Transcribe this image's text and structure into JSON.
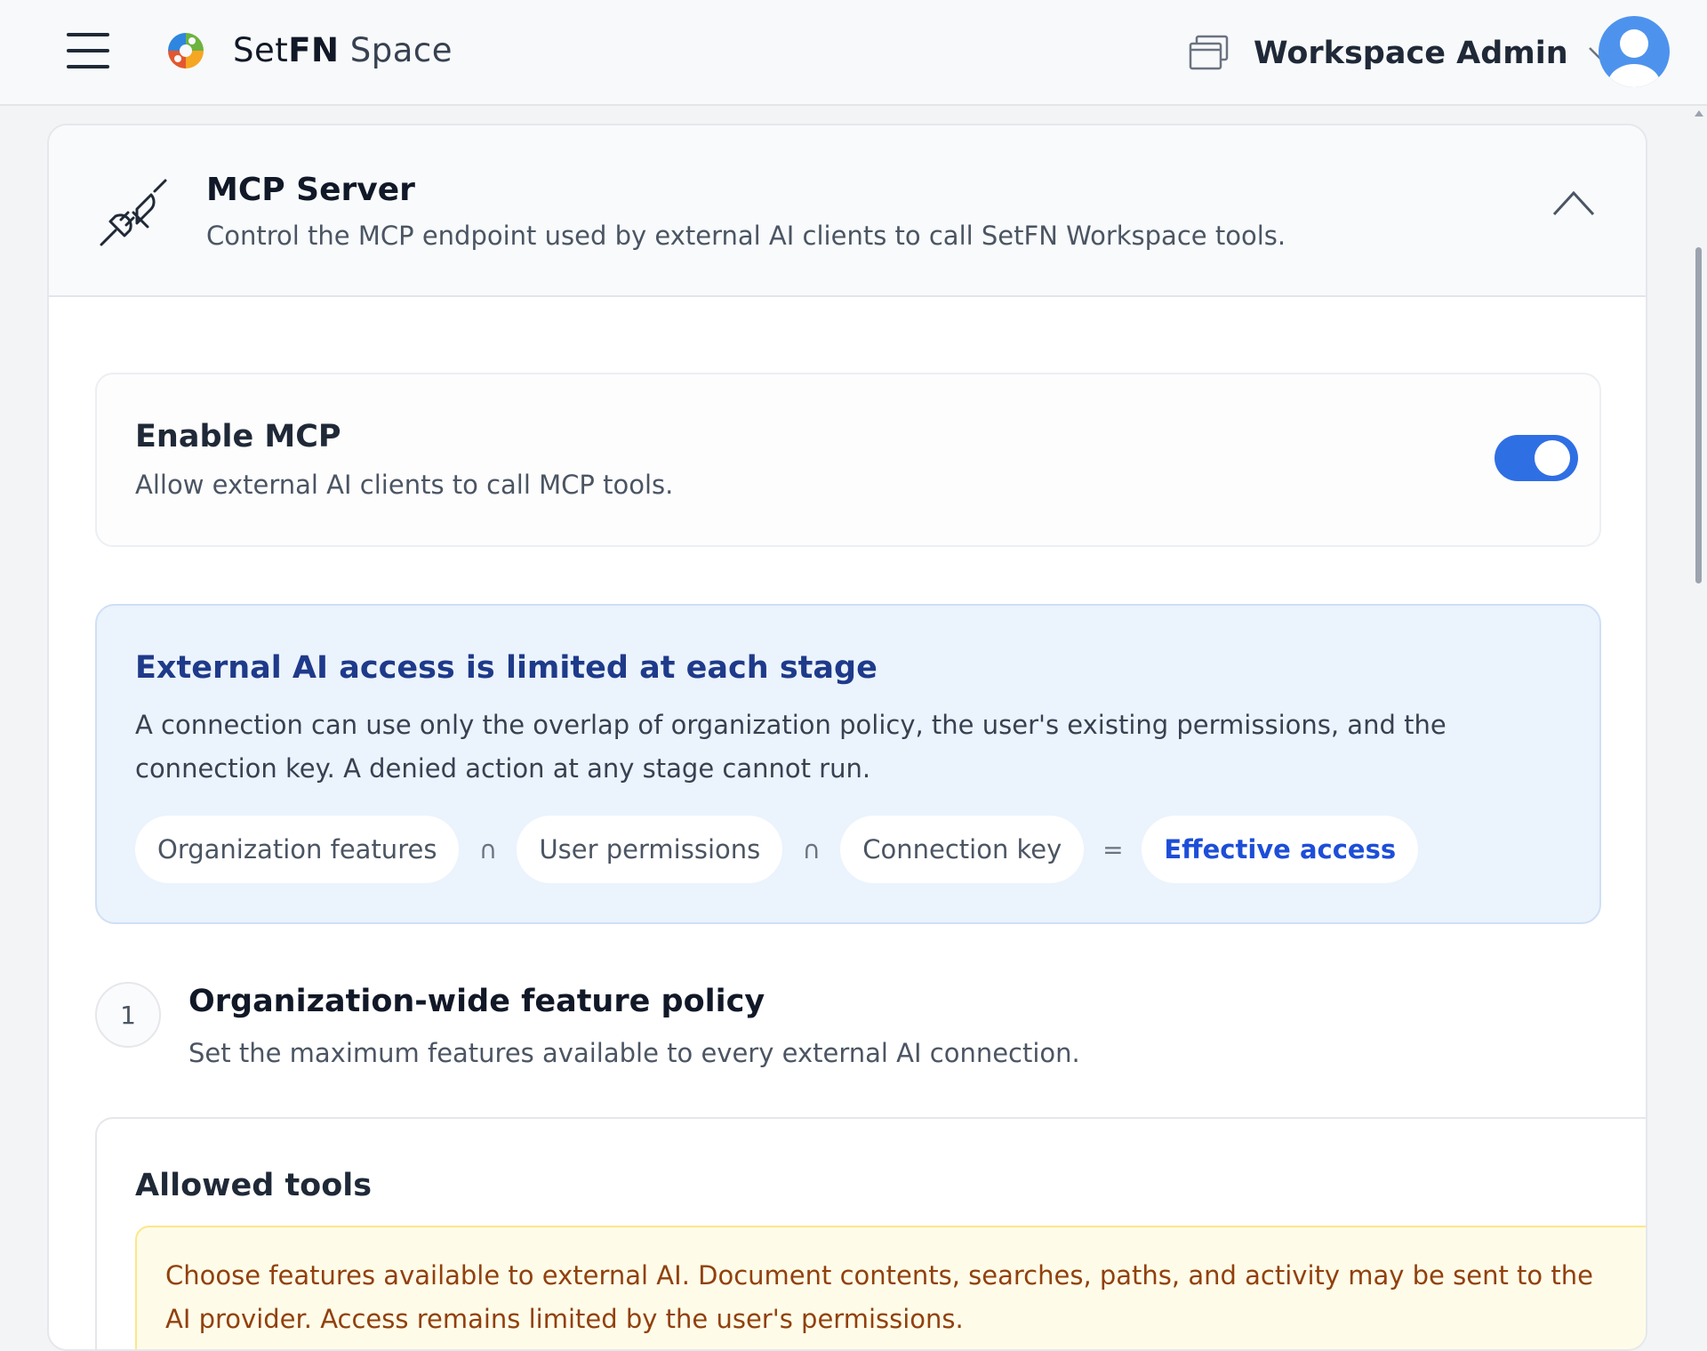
{
  "header": {
    "brand_part1": "Set",
    "brand_part2": "FN",
    "brand_part3": " Space",
    "workspace_name": "Workspace Admin"
  },
  "mcp": {
    "title": "MCP Server",
    "subtitle": "Control the MCP endpoint used by external AI clients to call SetFN Workspace tools.",
    "enable": {
      "title": "Enable MCP",
      "description": "Allow external AI clients to call MCP tools.",
      "enabled": true
    },
    "info": {
      "title": "External AI access is limited at each stage",
      "text": "A connection can use only the overlap of organization policy, the user's existing permissions, and the connection key. A denied action at any stage cannot run.",
      "pills": [
        "Organization features",
        "User permissions",
        "Connection key",
        "Effective access"
      ],
      "ops": [
        "∩",
        "∩",
        "="
      ]
    },
    "step1": {
      "number": "1",
      "title": "Organization-wide feature policy",
      "description": "Set the maximum features available to every external AI connection."
    },
    "tools": {
      "title": "Allowed tools",
      "warning": "Choose features available to external AI. Document contents, searches, paths, and activity may be sent to the AI provider. Access remains limited by the user's permissions."
    }
  },
  "icons": {
    "menu": "hamburger-menu-icon",
    "logo": "setfn-logo-icon",
    "workspace": "windows-stack-icon",
    "chevron": "chevron-down-icon",
    "avatar": "user-avatar-icon",
    "plug": "plug-icon",
    "collapse": "chevron-up-icon"
  },
  "colors": {
    "accent": "#2f6fe4",
    "info_bg": "#ebf3fd",
    "info_title": "#1e3a8a",
    "warning_bg": "#fefce8",
    "warning_text": "#92400e"
  }
}
